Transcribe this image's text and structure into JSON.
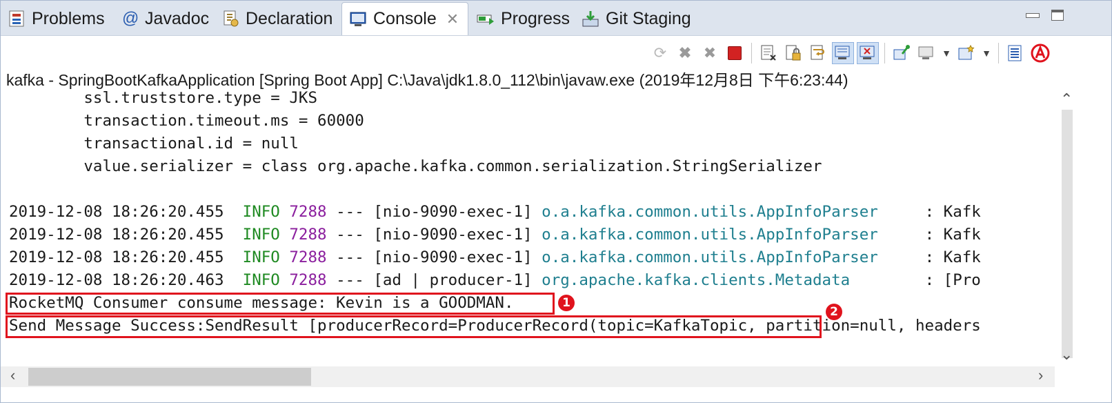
{
  "tabs": [
    {
      "label": "Problems",
      "icon": "problems-icon"
    },
    {
      "label": "Javadoc",
      "icon": "at-icon"
    },
    {
      "label": "Declaration",
      "icon": "declaration-icon"
    },
    {
      "label": "Console",
      "icon": "console-icon",
      "active": true
    },
    {
      "label": "Progress",
      "icon": "progress-icon"
    },
    {
      "label": "Git Staging",
      "icon": "git-staging-icon"
    }
  ],
  "process_label": "kafka - SpringBootKafkaApplication [Spring Boot App] C:\\Java\\jdk1.8.0_112\\bin\\javaw.exe (2019年12月8日 下午6:23:44)",
  "config_lines": [
    "        ssl.truststore.type = JKS",
    "        transaction.timeout.ms = 60000",
    "        transactional.id = null",
    "        value.serializer = class org.apache.kafka.common.serialization.StringSerializer"
  ],
  "log_lines": [
    {
      "ts": "2019-12-08 18:26:20.455",
      "level": "INFO",
      "pid": "7288",
      "sep": "---",
      "thread": "[nio-9090-exec-1]",
      "logger": "o.a.kafka.common.utils.AppInfoParser",
      "msg": ": Kafk"
    },
    {
      "ts": "2019-12-08 18:26:20.455",
      "level": "INFO",
      "pid": "7288",
      "sep": "---",
      "thread": "[nio-9090-exec-1]",
      "logger": "o.a.kafka.common.utils.AppInfoParser",
      "msg": ": Kafk"
    },
    {
      "ts": "2019-12-08 18:26:20.455",
      "level": "INFO",
      "pid": "7288",
      "sep": "---",
      "thread": "[nio-9090-exec-1]",
      "logger": "o.a.kafka.common.utils.AppInfoParser",
      "msg": ": Kafk"
    },
    {
      "ts": "2019-12-08 18:26:20.463",
      "level": "INFO",
      "pid": "7288",
      "sep": "---",
      "thread": "[ad | producer-1]",
      "logger": "org.apache.kafka.clients.Metadata",
      "msg": ": [Pro"
    }
  ],
  "highlight_1": {
    "text": "RocketMQ Consumer consume message: Kevin is a GOODMAN.",
    "marker": "1"
  },
  "highlight_2": {
    "text": "Send Message Success:SendResult [producerRecord=ProducerRecord(topic=KafkaTopic,",
    "rest": " partition=null, headers",
    "marker": "2"
  },
  "colors": {
    "accent_red": "#e0131d",
    "info_green": "#1f8a22",
    "pid_purple": "#8b1f9e",
    "logger_teal": "#1f7f8f"
  }
}
